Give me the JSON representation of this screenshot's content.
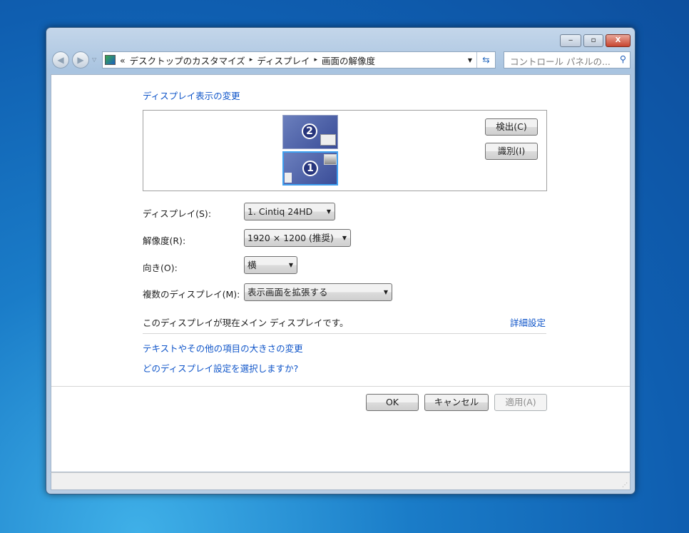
{
  "titlebar": {
    "minimize": "‒",
    "maximize": "▫",
    "close": "X"
  },
  "address": {
    "overflow": "«",
    "crumbs": [
      "デスクトップのカスタマイズ",
      "ディスプレイ",
      "画面の解像度"
    ],
    "sep": "▸"
  },
  "search": {
    "placeholder": "コントロール パネルの..."
  },
  "heading": "ディスプレイ表示の変更",
  "monitors": [
    {
      "number": "2"
    },
    {
      "number": "1",
      "selected": true
    }
  ],
  "detect_button": "検出(C)",
  "identify_button": "識別(I)",
  "settings": [
    {
      "label": "ディスプレイ(S):",
      "value": "1. Cintiq 24HD"
    },
    {
      "label": "解像度(R):",
      "value": "1920 × 1200 (推奨)"
    },
    {
      "label": "向き(O):",
      "value": "横"
    },
    {
      "label": "複数のディスプレイ(M):",
      "value": "表示画面を拡張する"
    }
  ],
  "main_display_text": "このディスプレイが現在メイン ディスプレイです。",
  "advanced_link": "詳細設定",
  "links": [
    "テキストやその他の項目の大きさの変更",
    "どのディスプレイ設定を選択しますか?"
  ],
  "buttons": {
    "ok": "OK",
    "cancel": "キャンセル",
    "apply": "適用(A)"
  }
}
